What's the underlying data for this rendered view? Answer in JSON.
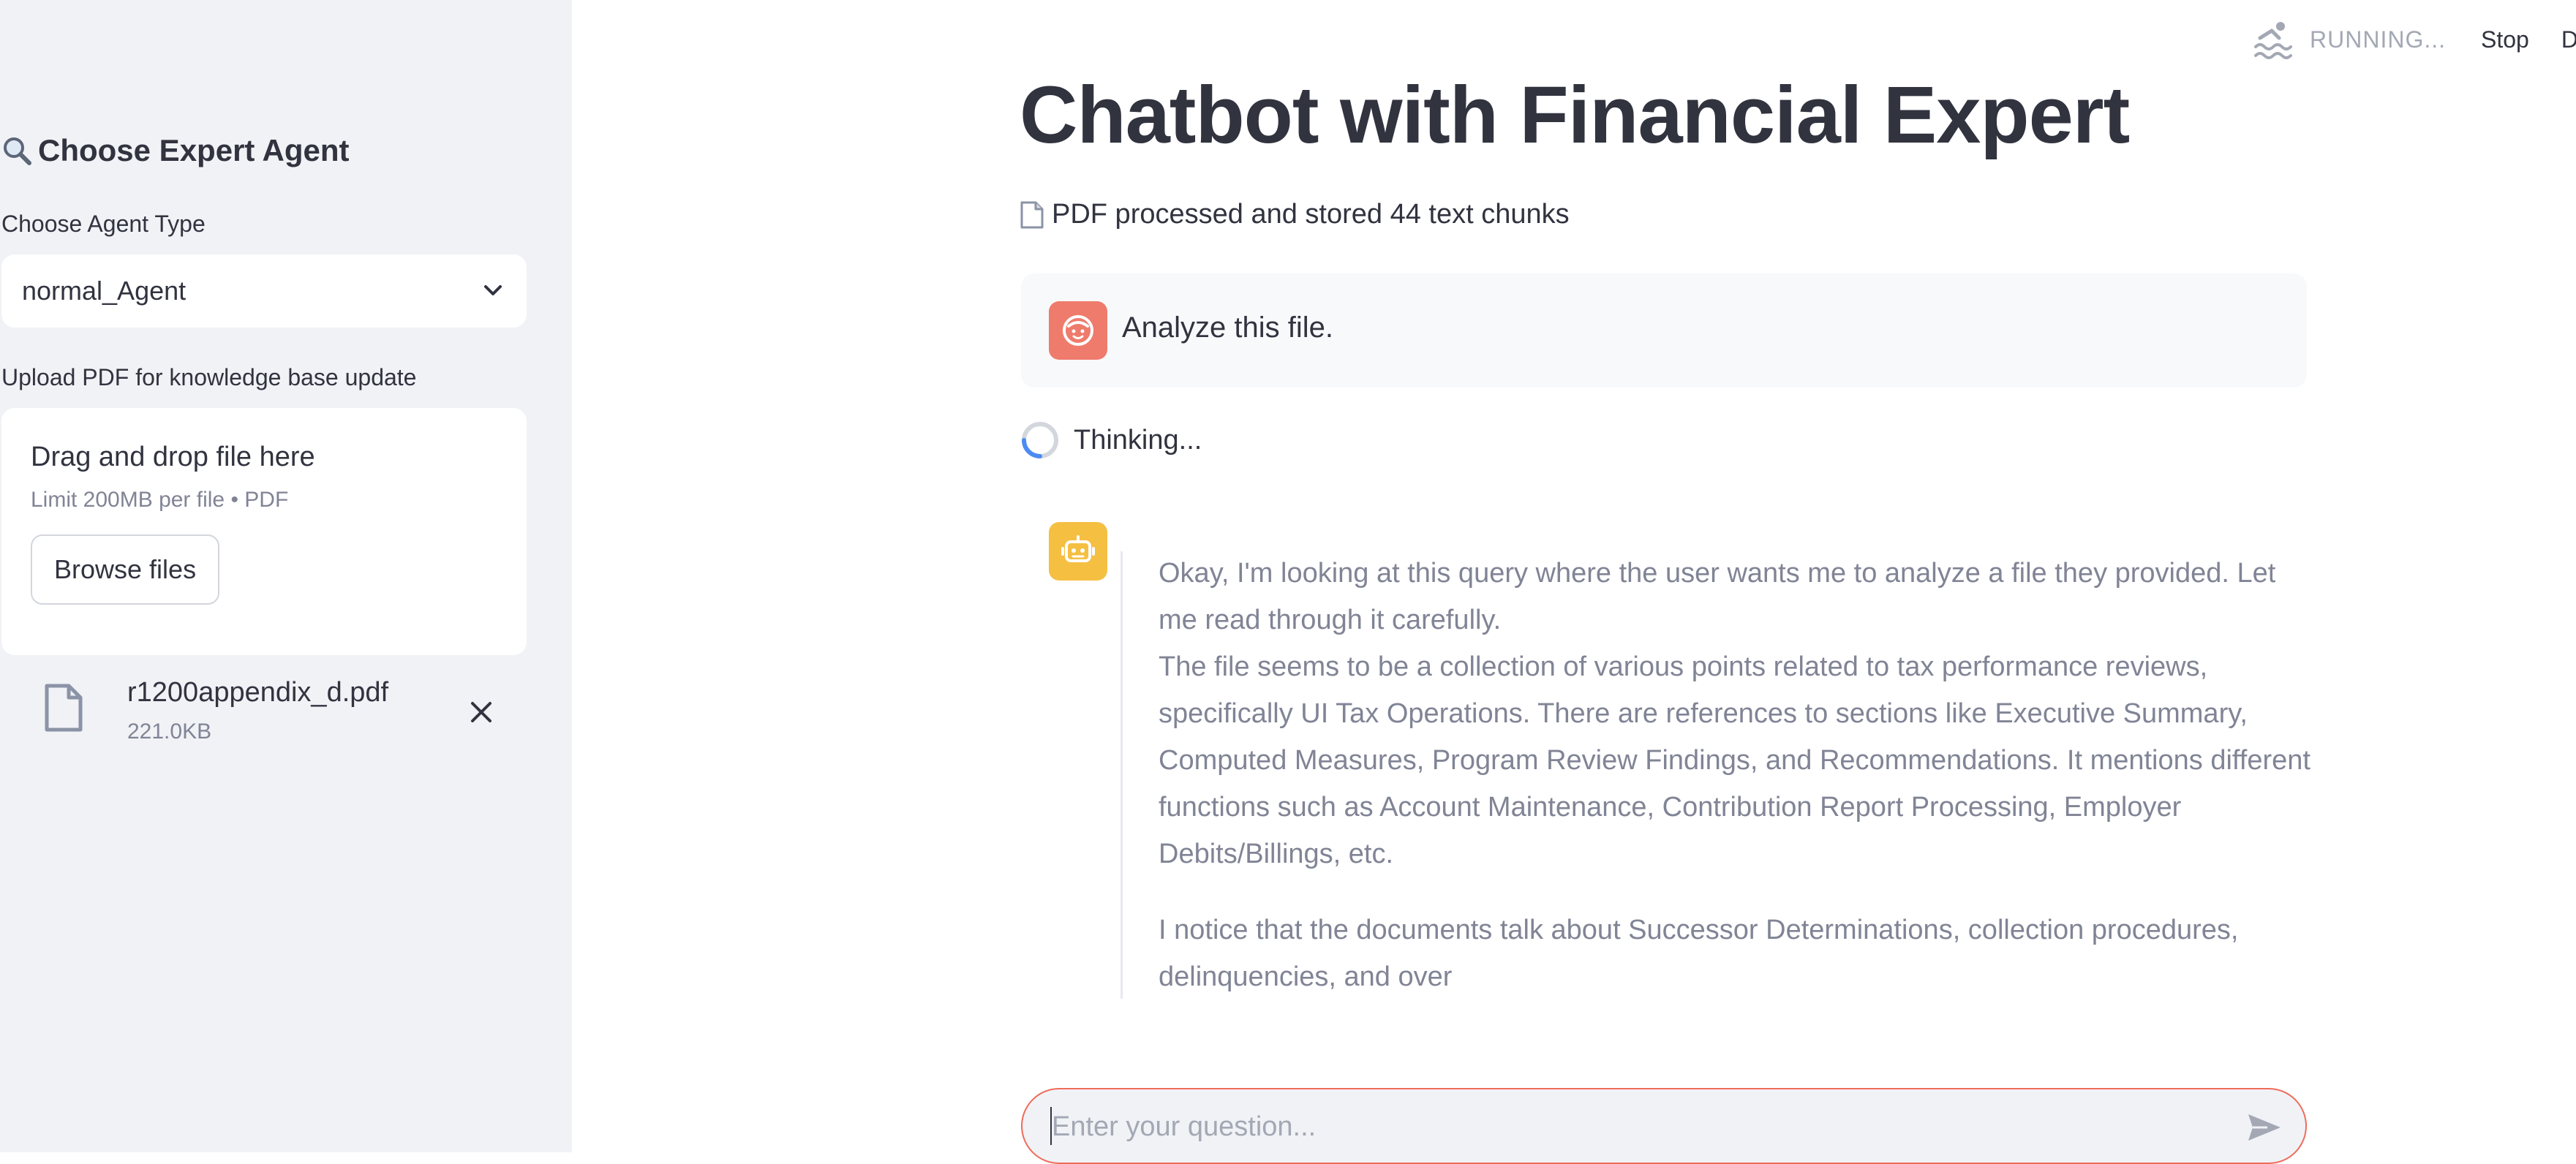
{
  "sidebar": {
    "title": "Choose Expert Agent",
    "agent_type_label": "Choose Agent Type",
    "agent_type_value": "normal_Agent",
    "upload_label": "Upload PDF for knowledge base update",
    "dropzone": {
      "title": "Drag and drop file here",
      "limit": "Limit 200MB per file • PDF",
      "browse_label": "Browse files"
    },
    "uploaded_file": {
      "name": "r1200appendix_d.pdf",
      "size": "221.0KB"
    }
  },
  "header": {
    "status_text": "RUNNING...",
    "stop_label": "Stop",
    "deploy_label": "D"
  },
  "main": {
    "title": "Chatbot with Financial Expert",
    "info_text": "PDF processed and stored 44 text chunks",
    "user_message": "Analyze this file.",
    "thinking_text": "Thinking...",
    "assistant_paragraphs": [
      "Okay, I'm looking at this query where the user wants me to analyze a file they provided. Let me read through it carefully.",
      "The file seems to be a collection of various points related to tax performance reviews, specifically UI Tax Operations. There are references to sections like Executive Summary, Computed Measures, Program Review Findings, and Recommendations. It mentions different functions such as Account Maintenance, Contribution Report Processing, Employer Debits/Billings, etc.",
      "I notice that the documents talk about Successor Determinations, collection procedures, delinquencies, and over"
    ],
    "chat_input_placeholder": "Enter your question..."
  },
  "colors": {
    "sidebar_bg": "#f0f2f6",
    "user_avatar": "#ef7b6c",
    "assistant_avatar": "#f5bf42",
    "input_border": "#ef6c5a",
    "muted_text": "#808495"
  },
  "icons": [
    "magnifier-icon",
    "chevron-down-icon",
    "file-icon",
    "close-icon",
    "swimmer-icon",
    "document-icon",
    "user-face-icon",
    "robot-icon",
    "spinner-icon",
    "send-icon"
  ]
}
